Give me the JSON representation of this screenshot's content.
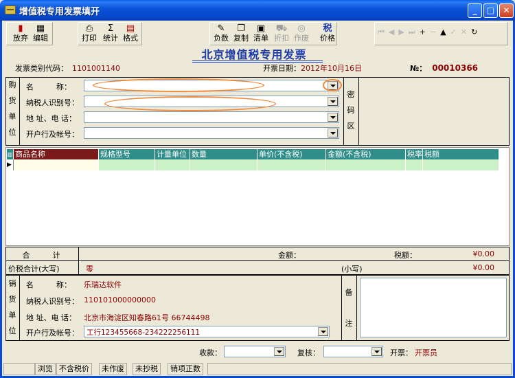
{
  "window": {
    "title": "增值税专用发票填开"
  },
  "toolbar": {
    "buttons": [
      {
        "label": "放弃",
        "icon": "abandon-icon"
      },
      {
        "label": "编辑",
        "icon": "edit-icon"
      },
      {
        "label": "打印",
        "icon": "printer-icon"
      },
      {
        "label": "统计",
        "icon": "sigma-icon"
      },
      {
        "label": "格式",
        "icon": "format-icon"
      },
      {
        "label": "负数",
        "icon": "negative-icon"
      },
      {
        "label": "复制",
        "icon": "copy-icon"
      },
      {
        "label": "清单",
        "icon": "list-icon"
      },
      {
        "label": "折扣",
        "icon": "discount-icon"
      },
      {
        "label": "作废",
        "icon": "void-icon"
      },
      {
        "label": "价格",
        "icon": "tax-icon",
        "glyph": "税"
      }
    ]
  },
  "invoice": {
    "title": "北京增值税专用发票",
    "type_code_label": "发票类别代码：",
    "type_code": "1101001140",
    "date_label": "开票日期：",
    "date": "2012年10月16日",
    "number_label": "№：",
    "number": "00010366"
  },
  "buyer": {
    "side_label": [
      "购",
      "货",
      "单",
      "位"
    ],
    "name_label": "名　　　称：",
    "taxid_label": "纳税人识别号：",
    "address_label": "地 址、电 话：",
    "bank_label": "开户行及帐号：",
    "name": "",
    "taxid": "",
    "address": "",
    "bank": ""
  },
  "cipher": {
    "label": [
      "密",
      "码",
      "区"
    ]
  },
  "items_table": {
    "headers": [
      "商品名称",
      "规格型号",
      "计量单位",
      "数量",
      "单价(不含税)",
      "金额(不含税)",
      "税率",
      "税额"
    ]
  },
  "totals": {
    "total_label": "合　　　计",
    "amount_label": "金额：",
    "amount": "¥0.00",
    "tax_label": "税额：",
    "tax": "¥0.00",
    "sum_label": "价税合计(大写)",
    "sum_upper": "零",
    "small_label": "(小写)",
    "sum_lower": "¥0.00"
  },
  "seller": {
    "side_label": [
      "销",
      "货",
      "单",
      "位"
    ],
    "name_label": "名　　　称：",
    "name": "乐瑞达软件",
    "taxid_label": "纳税人识别号：",
    "taxid": "110101000000000",
    "address_label": "地 址、电 话：",
    "address": "北京市海淀区知春路61号 66744498",
    "bank_label": "开户行及帐号：",
    "bank": "工行123455668-234222256111"
  },
  "remarks": {
    "label": [
      "备",
      "注"
    ]
  },
  "footer": {
    "payee_label": "收款：",
    "reviewer_label": "复核：",
    "issuer_label": "开票：",
    "issuer": "开票员"
  },
  "status": [
    "浏览",
    "不含税价",
    "未作废",
    "未抄税",
    "销项正数"
  ],
  "colors": {
    "accent_red": "#8b0000",
    "header_teal": "#2f8e8a",
    "title_blue": "#1c3aa8"
  }
}
